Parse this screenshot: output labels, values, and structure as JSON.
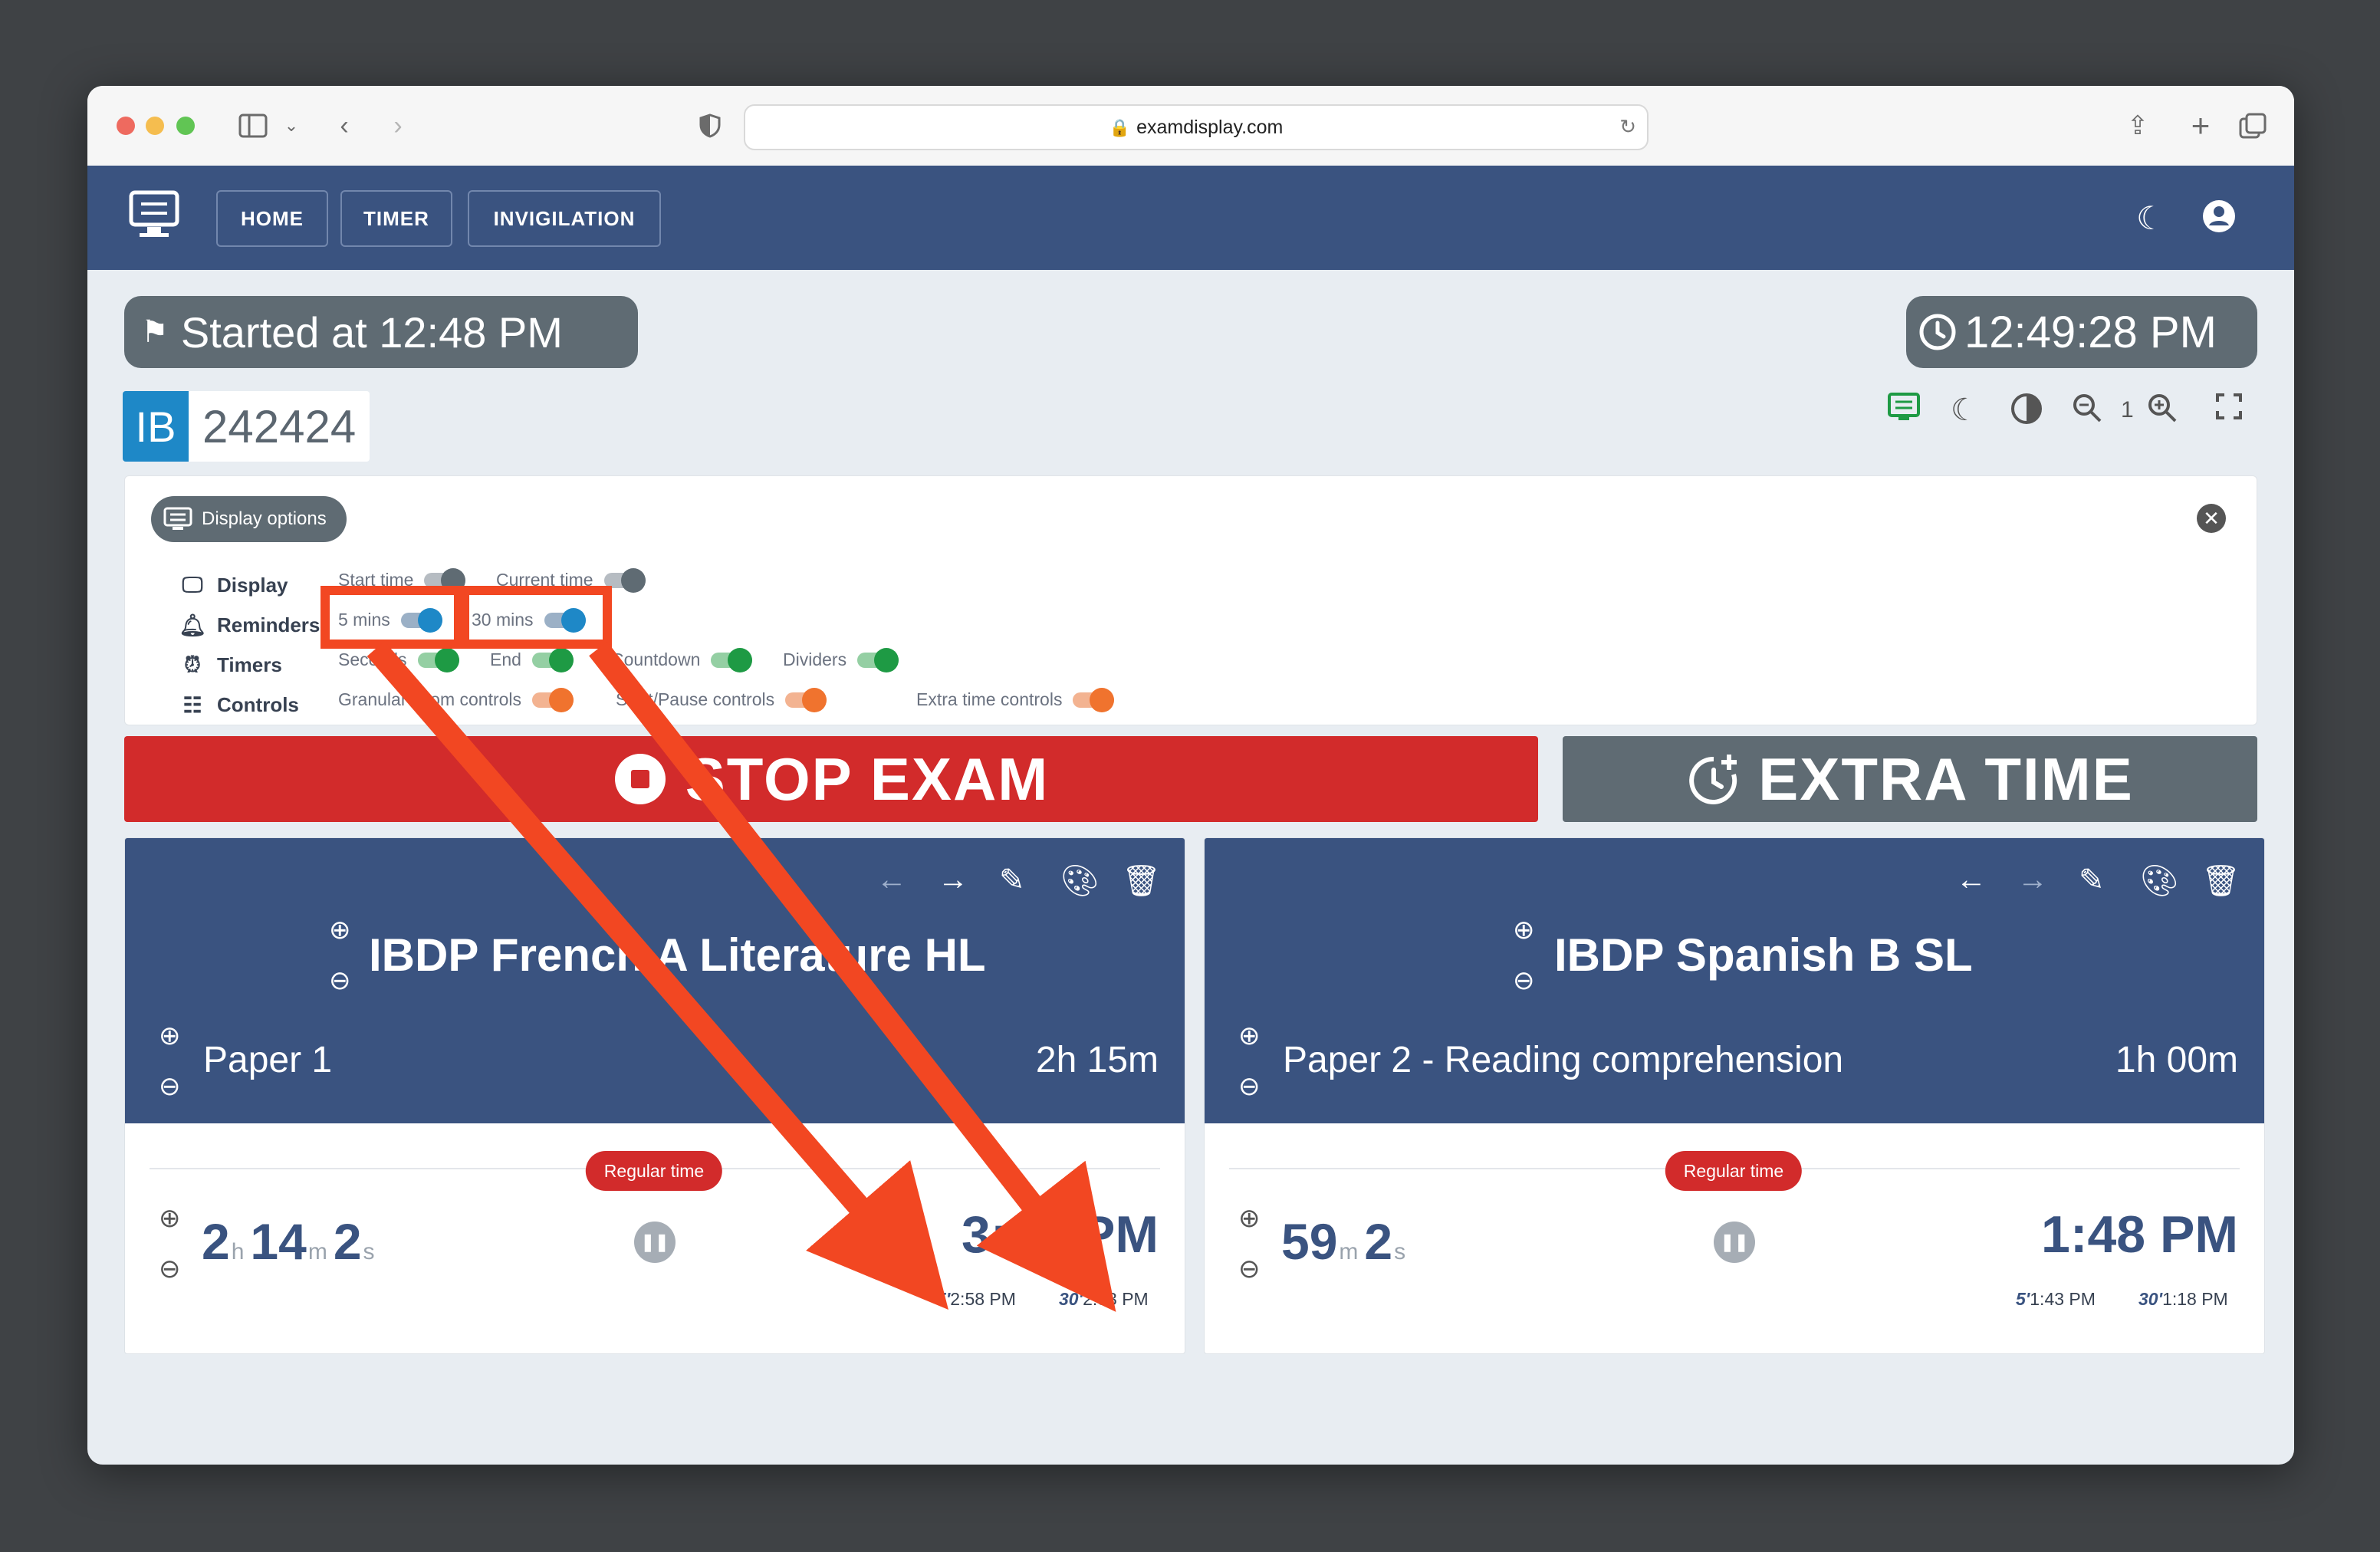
{
  "browser": {
    "url": "examdisplay.com"
  },
  "nav": {
    "items": [
      {
        "label": "HOME"
      },
      {
        "label": "TIMER"
      },
      {
        "label": "INVIGILATION"
      }
    ]
  },
  "status": {
    "started": "Started at 12:48 PM",
    "clock": "12:49:28 PM"
  },
  "center": {
    "code": "IB",
    "number": "242424",
    "zoom_level": "1"
  },
  "options": {
    "title": "Display options",
    "rows": [
      {
        "label": "Display",
        "items": [
          {
            "label": "Start time"
          },
          {
            "label": "Current time"
          }
        ]
      },
      {
        "label": "Reminders",
        "items": [
          {
            "label": "5 mins"
          },
          {
            "label": "30 mins"
          }
        ]
      },
      {
        "label": "Timers",
        "items": [
          {
            "label": "Seconds"
          },
          {
            "label": "End"
          },
          {
            "label": "Countdown"
          },
          {
            "label": "Dividers"
          }
        ]
      },
      {
        "label": "Controls",
        "items": [
          {
            "label": "Granular zoom controls"
          },
          {
            "label": "Start/Pause controls"
          },
          {
            "label": "Extra time controls"
          }
        ]
      }
    ]
  },
  "actions": {
    "stop": "STOP EXAM",
    "extra": "EXTRA TIME"
  },
  "exams": [
    {
      "title": "IBDP French A Literature HL",
      "paper": "Paper 1",
      "duration": "2h 15m",
      "badge": "Regular time",
      "countdown": {
        "h": "2",
        "h_unit": "h",
        "m": "14",
        "m_unit": "m",
        "s": "2",
        "s_unit": "s"
      },
      "end": "3:03 PM",
      "reminders": [
        {
          "mark": "5'",
          "time": "2:58 PM"
        },
        {
          "mark": "30'",
          "time": "2:33 PM"
        }
      ]
    },
    {
      "title": "IBDP Spanish B SL",
      "paper": "Paper 2 - Reading comprehension",
      "duration": "1h 00m",
      "badge": "Regular time",
      "countdown": {
        "m": "59",
        "m_unit": "m",
        "s": "2",
        "s_unit": "s"
      },
      "end": "1:48 PM",
      "reminders": [
        {
          "mark": "5'",
          "time": "1:43 PM"
        },
        {
          "mark": "30'",
          "time": "1:18 PM"
        }
      ]
    }
  ],
  "colors": {
    "navy": "#3a5380",
    "stop_red": "#d22b2b",
    "extra_grey": "#5f6b73",
    "annotation": "#f24722"
  }
}
